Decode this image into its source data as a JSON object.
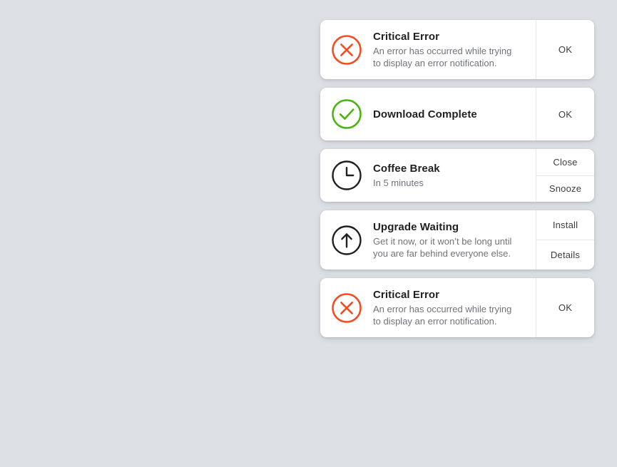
{
  "theme": {
    "page_background": "#dde0e4",
    "card_background": "#ffffff",
    "title_color": "#1f2023",
    "message_color": "#70747a",
    "action_color": "#3a3d42",
    "divider_color": "#e6e8ea",
    "error_accent": "#f04e23",
    "success_accent": "#4cb410",
    "neutral_accent": "#1f2023"
  },
  "notifications": [
    {
      "icon": "error-circle-x-icon",
      "icon_color": "#f04e23",
      "title": "Critical Error",
      "message": "An error has occurred while trying to display an error notification.",
      "actions": [
        {
          "label": "OK",
          "name": "ok-button"
        }
      ]
    },
    {
      "icon": "success-circle-check-icon",
      "icon_color": "#4cb410",
      "title": "Download Complete",
      "message": "",
      "actions": [
        {
          "label": "OK",
          "name": "ok-button"
        }
      ]
    },
    {
      "icon": "clock-icon",
      "icon_color": "#1f2023",
      "title": "Coffee Break",
      "message": "In 5 minutes",
      "actions": [
        {
          "label": "Close",
          "name": "close-button"
        },
        {
          "label": "Snooze",
          "name": "snooze-button"
        }
      ]
    },
    {
      "icon": "upgrade-arrow-up-circle-icon",
      "icon_color": "#1f2023",
      "title": "Upgrade Waiting",
      "message": "Get it now, or it won’t be long until you are far behind everyone else.",
      "actions": [
        {
          "label": "Install",
          "name": "install-button"
        },
        {
          "label": "Details",
          "name": "details-button"
        }
      ]
    },
    {
      "icon": "error-circle-x-icon",
      "icon_color": "#f04e23",
      "title": "Critical Error",
      "message": "An error has occurred while trying to display an error notification.",
      "actions": [
        {
          "label": "OK",
          "name": "ok-button"
        }
      ]
    }
  ]
}
